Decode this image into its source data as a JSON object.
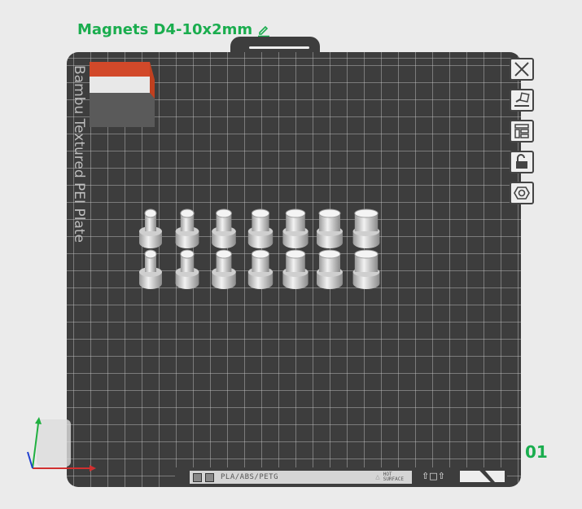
{
  "project": {
    "title": "Magnets D4-10x2mm",
    "edit_icon": "pencil-icon"
  },
  "plate": {
    "name": "Bambu Textured PEI Plate",
    "number": "01",
    "materials": "PLA/ABS/PETG",
    "warning_line1": "HOT",
    "warning_line2": "SURFACE",
    "arrows": "⇧□⇧"
  },
  "toolbar": [
    {
      "name": "close-plate",
      "icon": "close-icon"
    },
    {
      "name": "auto-orient",
      "icon": "auto-orient-icon"
    },
    {
      "name": "arrange",
      "icon": "arrange-icon"
    },
    {
      "name": "lock-plate",
      "icon": "unlock-icon"
    },
    {
      "name": "plate-settings",
      "icon": "hex-nut-icon"
    }
  ],
  "colors": {
    "accent": "#1aad4e",
    "plate": "#3d3d3d",
    "cube_top": "#d2492a"
  }
}
